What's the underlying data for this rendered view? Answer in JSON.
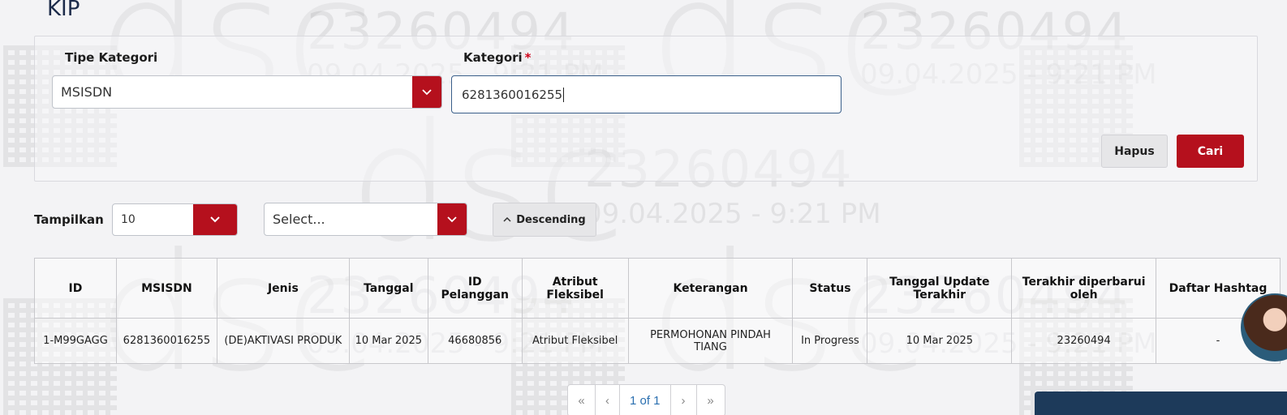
{
  "page": {
    "title": "KIP"
  },
  "watermark": {
    "number": "23260494",
    "datetime": "09.04.2025 - 9:21 PM",
    "logo": "dsc"
  },
  "filter": {
    "tipe_kategori_label": "Tipe Kategori",
    "tipe_kategori_value": "MSISDN",
    "kategori_label": "Kategori",
    "kategori_required": "*",
    "kategori_value": "6281360016255",
    "hapus_label": "Hapus",
    "cari_label": "Cari"
  },
  "controls": {
    "tampilkan_label": "Tampilkan",
    "page_size": "10",
    "sort_select_placeholder": "Select...",
    "order_label": "Descending",
    "order_icon": "chevron-up-icon"
  },
  "table": {
    "headers": [
      "ID",
      "MSISDN",
      "Jenis",
      "Tanggal",
      "ID Pelanggan",
      "Atribut Fleksibel",
      "Keterangan",
      "Status",
      "Tanggal Update Terakhir",
      "Terakhir diperbarui oleh",
      "Daftar Hashtag"
    ],
    "rows": [
      [
        "1-M99GAGG",
        "6281360016255",
        "(DE)AKTIVASI PRODUK",
        "10 Mar 2025",
        "46680856",
        "Atribut Fleksibel",
        "PERMOHONAN PINDAH TIANG",
        "In Progress",
        "10 Mar 2025",
        "23260494",
        "-"
      ]
    ]
  },
  "pagination": {
    "first": "«",
    "prev": "‹",
    "current": "1 of 1",
    "next": "›",
    "last": "»"
  },
  "colors": {
    "accent": "#b5101d",
    "title": "#1c2b4a",
    "link": "#2a6fb0"
  }
}
